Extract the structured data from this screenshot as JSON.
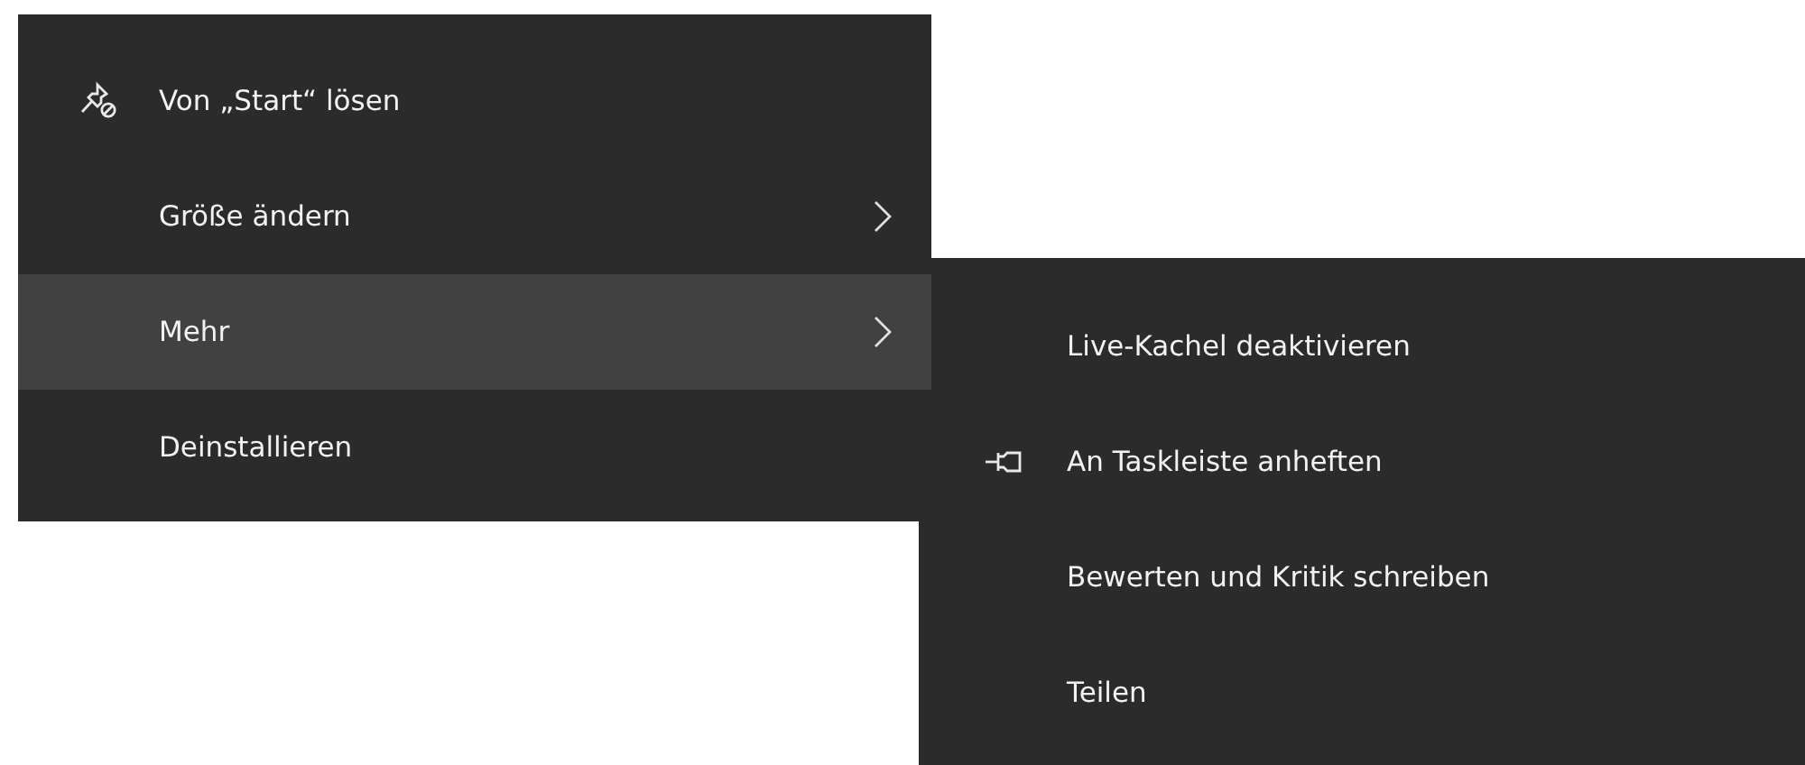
{
  "context_menu": {
    "items": [
      {
        "label": "Von „Start“ lösen",
        "kind": "unpin",
        "submenu": false,
        "selected": false
      },
      {
        "label": "Größe ändern",
        "kind": "plain",
        "submenu": true,
        "selected": false
      },
      {
        "label": "Mehr",
        "kind": "plain",
        "submenu": true,
        "selected": true
      },
      {
        "label": "Deinstallieren",
        "kind": "plain",
        "submenu": false,
        "selected": false
      }
    ]
  },
  "submenu": {
    "items": [
      {
        "label": "Live-Kachel deaktivieren",
        "kind": "plain"
      },
      {
        "label": "An Taskleiste anheften",
        "kind": "pin"
      },
      {
        "label": "Bewerten und Kritik schreiben",
        "kind": "plain"
      },
      {
        "label": "Teilen",
        "kind": "plain"
      }
    ]
  }
}
